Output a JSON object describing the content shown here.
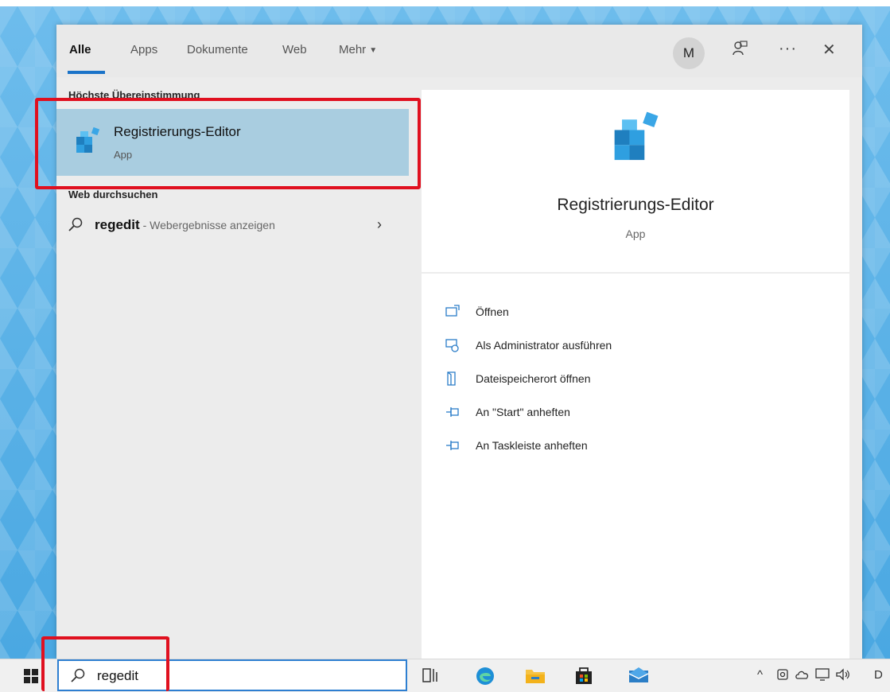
{
  "tabs": [
    {
      "label": "Alle",
      "active": true
    },
    {
      "label": "Apps",
      "active": false
    },
    {
      "label": "Dokumente",
      "active": false
    },
    {
      "label": "Web",
      "active": false
    },
    {
      "label": "Mehr",
      "active": false
    }
  ],
  "user": {
    "initial": "M"
  },
  "toolbar": {
    "feedback_icon": "feedback-icon",
    "more_icon": "more-icon",
    "close_icon": "close-icon",
    "more_glyph": "···",
    "close_glyph": "✕"
  },
  "results": {
    "best_match_label": "Höchste Übereinstimmung",
    "best_match": {
      "title": "Registrierungs-Editor",
      "subtitle": "App"
    },
    "web_label": "Web durchsuchen",
    "web_query": "regedit",
    "web_hint": " - Webergebnisse anzeigen"
  },
  "detail": {
    "title": "Registrierungs-Editor",
    "subtitle": "App",
    "actions": [
      {
        "label": "Öffnen",
        "icon": "open-icon"
      },
      {
        "label": "Als Administrator ausführen",
        "icon": "run-as-admin-icon"
      },
      {
        "label": "Dateispeicherort öffnen",
        "icon": "file-location-icon"
      },
      {
        "label": "An \"Start\" anheften",
        "icon": "pin-icon"
      },
      {
        "label": "An Taskleiste anheften",
        "icon": "pin-icon"
      }
    ]
  },
  "taskbar": {
    "search_value": "regedit",
    "tray_partial": "D"
  },
  "colors": {
    "accent": "#1a73c8",
    "highlight": "#a9cde0",
    "annotation": "#e0101f"
  }
}
